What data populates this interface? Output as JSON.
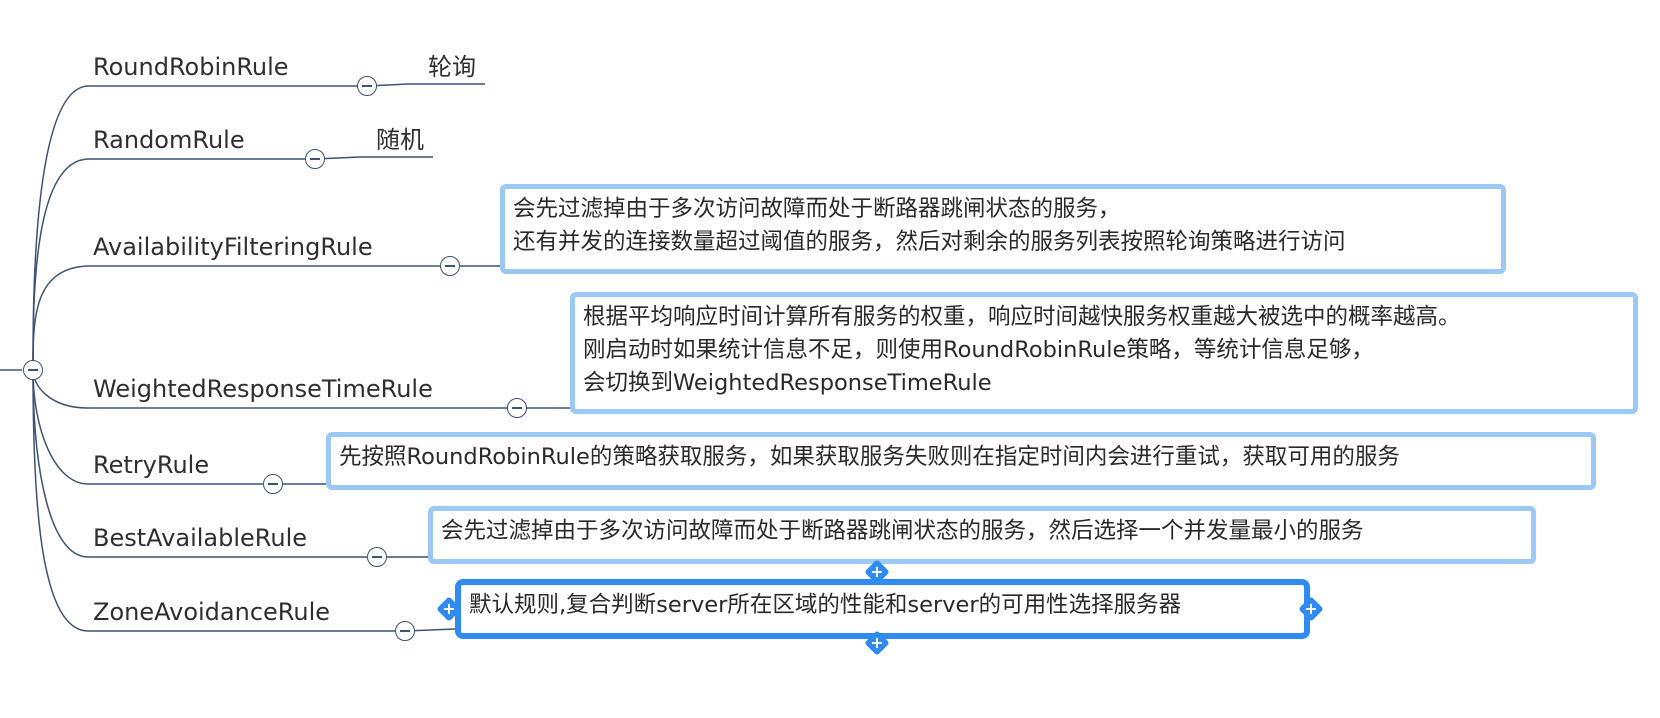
{
  "rules": [
    {
      "name": "RoundRobinRule",
      "label": "轮询"
    },
    {
      "name": "RandomRule",
      "label": "随机"
    },
    {
      "name": "AvailabilityFilteringRule",
      "description": [
        "会先过滤掉由于多次访问故障而处于断路器跳闸状态的服务，",
        "还有并发的连接数量超过阈值的服务，然后对剩余的服务列表按照轮询策略进行访问"
      ]
    },
    {
      "name": "WeightedResponseTimeRule",
      "description": [
        "根据平均响应时间计算所有服务的权重，响应时间越快服务权重越大被选中的概率越高。",
        "刚启动时如果统计信息不足，则使用RoundRobinRule策略，等统计信息足够，",
        "会切换到WeightedResponseTimeRule"
      ]
    },
    {
      "name": "RetryRule",
      "description": [
        "先按照RoundRobinRule的策略获取服务，如果获取服务失败则在指定时间内会进行重试，获取可用的服务"
      ]
    },
    {
      "name": "BestAvailableRule",
      "description": [
        "会先过滤掉由于多次访问故障而处于断路器跳闸状态的服务，然后选择一个并发量最小的服务"
      ]
    },
    {
      "name": "ZoneAvoidanceRule",
      "description": [
        "默认规则,复合判断server所在区域的性能和server的可用性选择服务器"
      ]
    }
  ],
  "colors": {
    "connector": "#3f5373",
    "box_border": "#9cc8f6",
    "box_selected_border": "#2f8bf0",
    "text": "#2f2f2f"
  },
  "icons": {
    "collapse": "minus-circle-icon",
    "add": "plus-diamond-icon"
  }
}
